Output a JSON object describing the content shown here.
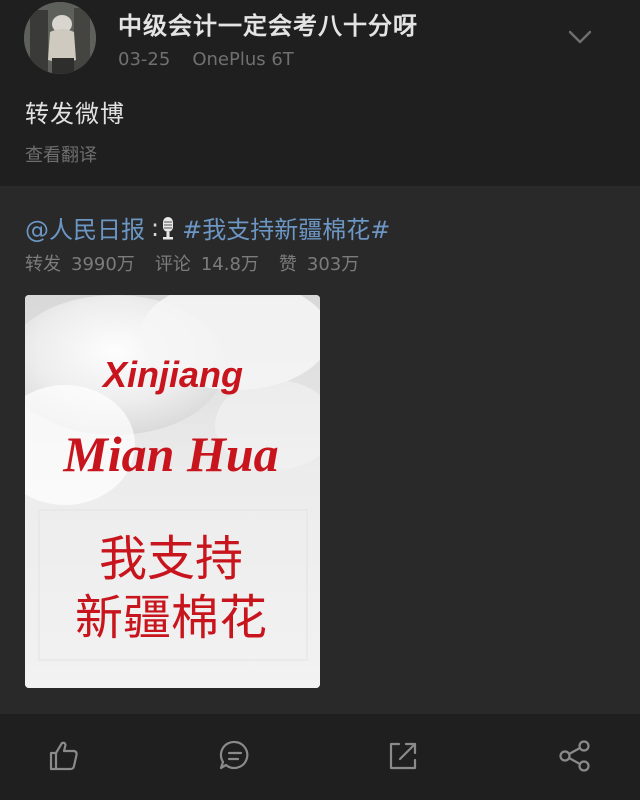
{
  "post": {
    "author": "中级会计一定会考八十分呀",
    "date": "03-25",
    "device": "OnePlus 6T",
    "text": "转发微博",
    "translate_label": "查看翻译"
  },
  "repost": {
    "mention": "@人民日报",
    "colon": ":",
    "hashtag": "#我支持新疆棉花#",
    "stats": {
      "repost_label": "转发",
      "repost_count": "3990万",
      "comment_label": "评论",
      "comment_count": "14.8万",
      "like_label": "赞",
      "like_count": "303万"
    },
    "image": {
      "line1": "Xinjiang",
      "line2": "Mian Hua",
      "line3": "我支持",
      "line4": "新疆棉花"
    }
  },
  "actions": {
    "like_icon": "thumbs-up-icon",
    "comment_icon": "comment-icon",
    "repost_icon": "repost-icon",
    "share_icon": "share-icon"
  },
  "colors": {
    "background": "#1f1f1f",
    "card": "#292929",
    "link": "#6c96c4",
    "image_red": "#c8141c"
  }
}
